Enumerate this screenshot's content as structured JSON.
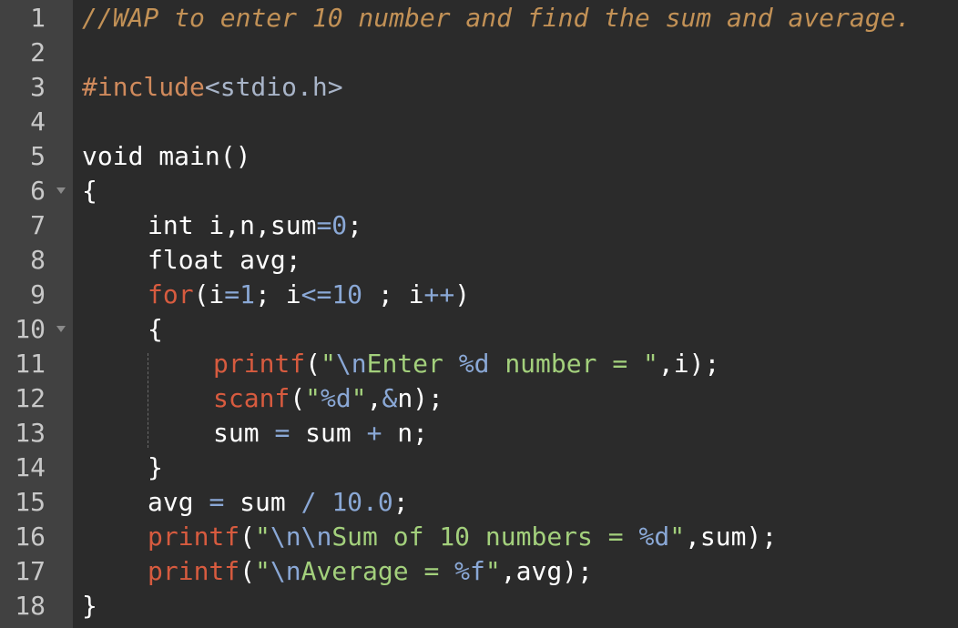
{
  "editor": {
    "theme_colors": {
      "background": "#2b2b2b",
      "gutter": "#414141",
      "comment": "#c29156",
      "keyword": "#d75b3f",
      "string": "#a3d07c",
      "number": "#8aa8d6",
      "plain": "#ffffff"
    },
    "lines": [
      {
        "number": "1",
        "fold": false,
        "indent": 0,
        "tokens": [
          {
            "text": "//WAP to enter 10 number and find the sum and average.",
            "type": "comment"
          }
        ]
      },
      {
        "number": "2",
        "fold": false,
        "indent": 0,
        "tokens": []
      },
      {
        "number": "3",
        "fold": false,
        "indent": 0,
        "tokens": [
          {
            "text": "#include",
            "type": "directive"
          },
          {
            "text": "<stdio.h>",
            "type": "header"
          }
        ]
      },
      {
        "number": "4",
        "fold": false,
        "indent": 0,
        "tokens": []
      },
      {
        "number": "5",
        "fold": false,
        "indent": 0,
        "tokens": [
          {
            "text": "void main()",
            "type": "plain"
          }
        ]
      },
      {
        "number": "6",
        "fold": true,
        "indent": 0,
        "tokens": [
          {
            "text": "{",
            "type": "plain"
          }
        ]
      },
      {
        "number": "7",
        "fold": false,
        "indent": 1,
        "tokens": [
          {
            "text": "int i,n,sum",
            "type": "plain"
          },
          {
            "text": "=",
            "type": "operator"
          },
          {
            "text": "0",
            "type": "number"
          },
          {
            "text": ";",
            "type": "plain"
          }
        ]
      },
      {
        "number": "8",
        "fold": false,
        "indent": 1,
        "tokens": [
          {
            "text": "float avg;",
            "type": "plain"
          }
        ]
      },
      {
        "number": "9",
        "fold": false,
        "indent": 1,
        "tokens": [
          {
            "text": "for",
            "type": "keyword"
          },
          {
            "text": "(i",
            "type": "plain"
          },
          {
            "text": "=",
            "type": "operator"
          },
          {
            "text": "1",
            "type": "number"
          },
          {
            "text": "; i",
            "type": "plain"
          },
          {
            "text": "<=",
            "type": "operator"
          },
          {
            "text": "10",
            "type": "number"
          },
          {
            "text": " ; i",
            "type": "plain"
          },
          {
            "text": "++",
            "type": "operator"
          },
          {
            "text": ")",
            "type": "plain"
          }
        ]
      },
      {
        "number": "10",
        "fold": true,
        "indent": 1,
        "tokens": [
          {
            "text": "{",
            "type": "plain"
          }
        ]
      },
      {
        "number": "11",
        "fold": false,
        "indent": 2,
        "tokens": [
          {
            "text": "printf",
            "type": "func"
          },
          {
            "text": "(",
            "type": "plain"
          },
          {
            "text": "\"",
            "type": "string"
          },
          {
            "text": "\\n",
            "type": "escape"
          },
          {
            "text": "Enter ",
            "type": "string"
          },
          {
            "text": "%d",
            "type": "format"
          },
          {
            "text": " number = \"",
            "type": "string"
          },
          {
            "text": ",i);",
            "type": "plain"
          }
        ]
      },
      {
        "number": "12",
        "fold": false,
        "indent": 2,
        "tokens": [
          {
            "text": "scanf",
            "type": "func"
          },
          {
            "text": "(",
            "type": "plain"
          },
          {
            "text": "\"",
            "type": "string"
          },
          {
            "text": "%d",
            "type": "format"
          },
          {
            "text": "\"",
            "type": "string"
          },
          {
            "text": ",",
            "type": "plain"
          },
          {
            "text": "&",
            "type": "operator"
          },
          {
            "text": "n);",
            "type": "plain"
          }
        ]
      },
      {
        "number": "13",
        "fold": false,
        "indent": 2,
        "tokens": [
          {
            "text": "sum ",
            "type": "plain"
          },
          {
            "text": "=",
            "type": "operator"
          },
          {
            "text": " sum ",
            "type": "plain"
          },
          {
            "text": "+",
            "type": "operator"
          },
          {
            "text": " n;",
            "type": "plain"
          }
        ]
      },
      {
        "number": "14",
        "fold": false,
        "indent": 1,
        "tokens": [
          {
            "text": "}",
            "type": "plain"
          }
        ]
      },
      {
        "number": "15",
        "fold": false,
        "indent": 1,
        "tokens": [
          {
            "text": "avg ",
            "type": "plain"
          },
          {
            "text": "=",
            "type": "operator"
          },
          {
            "text": " sum ",
            "type": "plain"
          },
          {
            "text": "/",
            "type": "operator"
          },
          {
            "text": " ",
            "type": "plain"
          },
          {
            "text": "10.0",
            "type": "number"
          },
          {
            "text": ";",
            "type": "plain"
          }
        ]
      },
      {
        "number": "16",
        "fold": false,
        "indent": 1,
        "tokens": [
          {
            "text": "printf",
            "type": "func"
          },
          {
            "text": "(",
            "type": "plain"
          },
          {
            "text": "\"",
            "type": "string"
          },
          {
            "text": "\\n\\n",
            "type": "escape"
          },
          {
            "text": "Sum of 10 numbers = ",
            "type": "string"
          },
          {
            "text": "%d",
            "type": "format"
          },
          {
            "text": "\"",
            "type": "string"
          },
          {
            "text": ",sum);",
            "type": "plain"
          }
        ]
      },
      {
        "number": "17",
        "fold": false,
        "indent": 1,
        "tokens": [
          {
            "text": "printf",
            "type": "func"
          },
          {
            "text": "(",
            "type": "plain"
          },
          {
            "text": "\"",
            "type": "string"
          },
          {
            "text": "\\n",
            "type": "escape"
          },
          {
            "text": "Average = ",
            "type": "string"
          },
          {
            "text": "%f",
            "type": "format"
          },
          {
            "text": "\"",
            "type": "string"
          },
          {
            "text": ",avg);",
            "type": "plain"
          }
        ]
      },
      {
        "number": "18",
        "fold": false,
        "indent": 0,
        "tokens": [
          {
            "text": "}",
            "type": "plain"
          }
        ]
      }
    ]
  }
}
